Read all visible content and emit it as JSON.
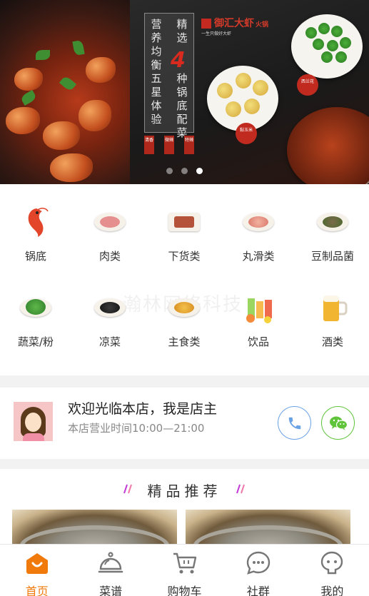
{
  "banner": {
    "poster_col1": "营养均衡",
    "poster_col2": "五星体验",
    "poster_col3a": "精选",
    "poster_big": "4",
    "poster_col3b": "种锅底配菜",
    "tags": [
      "清香",
      "微辣",
      "特辣"
    ],
    "brand_name": "御汇大虾",
    "brand_tag": "火锅",
    "brand_sub": "一生只做好大虾",
    "dish_label_1": "西兰花",
    "dish_label_2": "黏玉米",
    "carousel": {
      "count": 3,
      "active_index": 2
    }
  },
  "categories": [
    {
      "label": "锅底",
      "icon": "shrimp-icon"
    },
    {
      "label": "肉类",
      "icon": "meat-plate-icon"
    },
    {
      "label": "下货类",
      "icon": "offal-plate-icon"
    },
    {
      "label": "丸滑类",
      "icon": "meatball-plate-icon"
    },
    {
      "label": "豆制品菌",
      "icon": "tofu-mushroom-icon"
    },
    {
      "label": "蔬菜/粉",
      "icon": "vegetable-icon"
    },
    {
      "label": "凉菜",
      "icon": "cold-dish-icon"
    },
    {
      "label": "主食类",
      "icon": "staple-food-icon"
    },
    {
      "label": "饮品",
      "icon": "drinks-icon"
    },
    {
      "label": "酒类",
      "icon": "beer-icon"
    }
  ],
  "watermark": "瀚林网络科技",
  "owner": {
    "title": "欢迎光临本店，我是店主",
    "hours": "本店营业时间10:00—21:00"
  },
  "featured": {
    "title": "精品推荐"
  },
  "tabbar": [
    {
      "label": "首页",
      "icon": "home-icon",
      "active": true
    },
    {
      "label": "菜谱",
      "icon": "cloche-icon",
      "active": false
    },
    {
      "label": "购物车",
      "icon": "cart-icon",
      "active": false
    },
    {
      "label": "社群",
      "icon": "chat-bubble-icon",
      "active": false
    },
    {
      "label": "我的",
      "icon": "user-icon",
      "active": false
    }
  ],
  "colors": {
    "accent": "#f07a0c",
    "phone": "#6aa2e6",
    "wechat": "#5fc43a",
    "featured_slash": "#c23bd6"
  }
}
